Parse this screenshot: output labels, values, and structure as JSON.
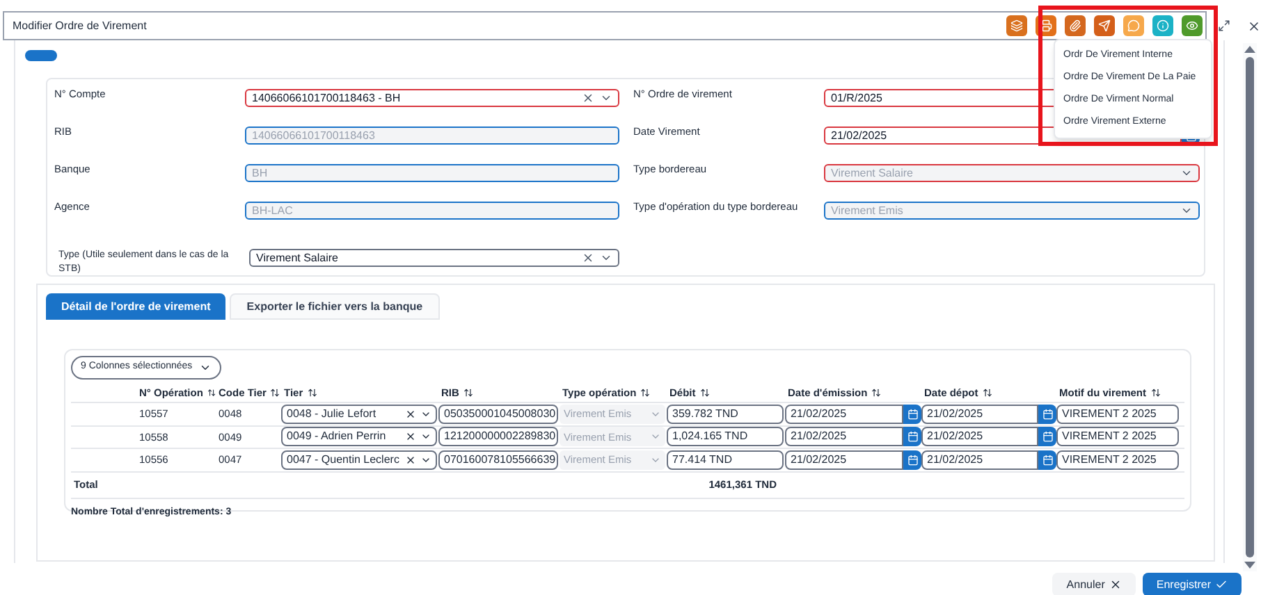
{
  "window": {
    "title": "Modifier Ordre de Virement"
  },
  "toolbar": [
    {
      "color": "#d9701e"
    },
    {
      "color": "#e2701a"
    },
    {
      "color": "#d4681f"
    },
    {
      "color": "#d45f1a"
    },
    {
      "color": "#f6a84b"
    },
    {
      "color": "#1bb2c6"
    },
    {
      "color": "#4f9a2b"
    }
  ],
  "menu": {
    "items": [
      "Ordr De Virement Interne",
      "Ordre De Virement De La Paie",
      "Ordre De Virment Normal",
      "Ordre Virement Externe"
    ]
  },
  "form": {
    "rows": [
      [
        {
          "label": "N° Compte",
          "value": "14066066101700118463 - BH",
          "kind": "select",
          "invalid": true,
          "disabled": false,
          "clearable": true
        },
        {
          "label": "N° Ordre de virement",
          "value": "01/R/2025",
          "kind": "input",
          "invalid": true,
          "disabled": false,
          "clearable": false
        }
      ],
      [
        {
          "label": "RIB",
          "value": "14066066101700118463",
          "kind": "input",
          "invalid": false,
          "validated": true,
          "disabled": true,
          "clearable": false
        },
        {
          "label": "Date Virement",
          "value": "21/02/2025",
          "kind": "date",
          "invalid": true,
          "disabled": false,
          "clearable": false
        }
      ],
      [
        {
          "label": "Banque",
          "value": "BH",
          "kind": "input",
          "invalid": false,
          "validated": true,
          "disabled": true,
          "clearable": false
        },
        {
          "label": "Type bordereau",
          "value": "Virement Salaire",
          "kind": "select",
          "invalid": true,
          "disabled": true,
          "clearable": false
        }
      ],
      [
        {
          "label": "Agence",
          "value": "BH-LAC",
          "kind": "input",
          "invalid": false,
          "validated": true,
          "disabled": true,
          "clearable": false
        },
        {
          "label": "Type d'opération du type bordereau",
          "value": "Virement Emis",
          "kind": "select",
          "invalid": false,
          "validated": true,
          "disabled": true,
          "clearable": false
        }
      ],
      [
        {
          "label": "Type (Utile seulement dans le cas de la STB)",
          "value": "Virement Salaire",
          "kind": "select",
          "invalid": false,
          "validated": false,
          "disabled": false,
          "clearable": true
        }
      ]
    ]
  },
  "tabs": [
    {
      "label": "Détail de l'ordre de virement",
      "selected": true
    },
    {
      "label": "Exporter le fichier vers la banque",
      "selected": false
    }
  ],
  "grid": {
    "columns_button": "9 Colonnes sélectionnées",
    "columns": [
      "N° Opération",
      "Code Tier",
      "Tier",
      "RIB",
      "Type opération",
      "Débit",
      "Date d'émission",
      "Date dépot",
      "Motif du virement"
    ],
    "rows": [
      {
        "operation": "10557",
        "code": "0048",
        "tier": "0048 - Julie Lefort",
        "rib": "050350001045008030",
        "type": "Virement Emis",
        "debit": "359.782 TND",
        "date_emission": "21/02/2025",
        "date_depot": "21/02/2025",
        "motif": "VIREMENT 2 2025"
      },
      {
        "operation": "10558",
        "code": "0049",
        "tier": "0049 - Adrien Perrin",
        "rib": "121200000002289830",
        "type": "Virement Emis",
        "debit": "1,024.165 TND",
        "date_emission": "21/02/2025",
        "date_depot": "21/02/2025",
        "motif": "VIREMENT 2 2025"
      },
      {
        "operation": "10556",
        "code": "0047",
        "tier": "0047 - Quentin Leclerc",
        "rib": "070160078105566639",
        "type": "Virement Emis",
        "debit": "77.414 TND",
        "date_emission": "21/02/2025",
        "date_depot": "21/02/2025",
        "motif": "VIREMENT 2 2025"
      }
    ],
    "total_label": "Total",
    "total_debit": "1461,361 TND",
    "record_count": "Nombre Total d'enregistrements: 3"
  },
  "footer": [
    {
      "label": "Annuler",
      "kind": "cancel"
    },
    {
      "label": "Enregistrer",
      "kind": "primary"
    }
  ]
}
